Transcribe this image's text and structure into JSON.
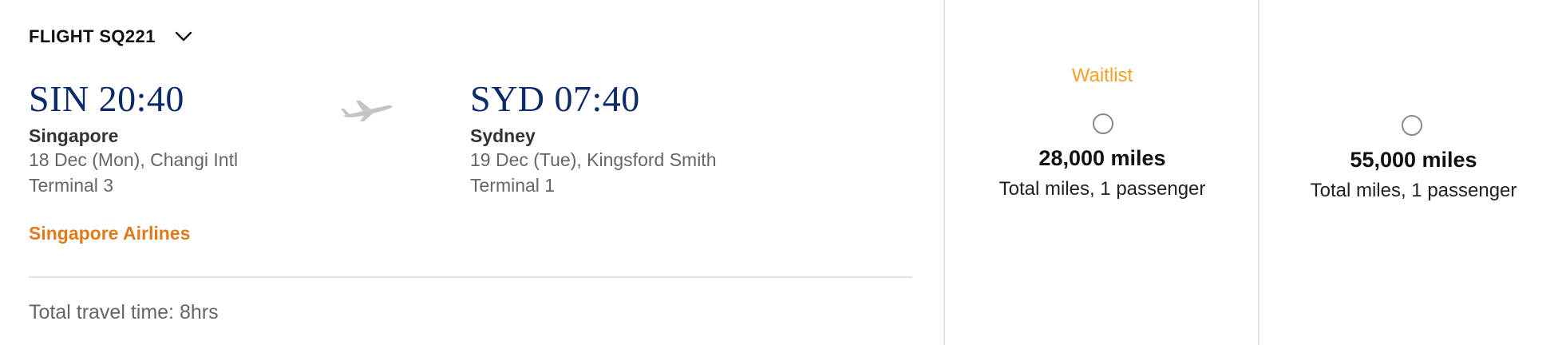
{
  "flight": {
    "number": "FLIGHT SQ221",
    "origin": {
      "code_time": "SIN 20:40",
      "city": "Singapore",
      "date_airport": "18 Dec (Mon), Changi Intl",
      "terminal": "Terminal 3"
    },
    "destination": {
      "code_time": "SYD 07:40",
      "city": "Sydney",
      "date_airport": "19 Dec (Tue), Kingsford Smith",
      "terminal": "Terminal 1"
    },
    "operator": "Singapore Airlines",
    "travel_time": "Total travel time: 8hrs"
  },
  "fares": [
    {
      "status": "Waitlist",
      "miles": "28,000 miles",
      "subtitle": "Total miles, 1 passenger",
      "selected": false
    },
    {
      "status": "",
      "miles": "55,000 miles",
      "subtitle": "Total miles, 1 passenger",
      "selected": false
    }
  ],
  "colors": {
    "airport_code": "#0b2a6b",
    "operator": "#e07a1b",
    "waitlist": "#f4a029",
    "divider": "#e2e2e2"
  },
  "icons": {
    "expand": "chevron-down-icon",
    "plane": "plane-icon",
    "fare_select": "radio-icon"
  }
}
